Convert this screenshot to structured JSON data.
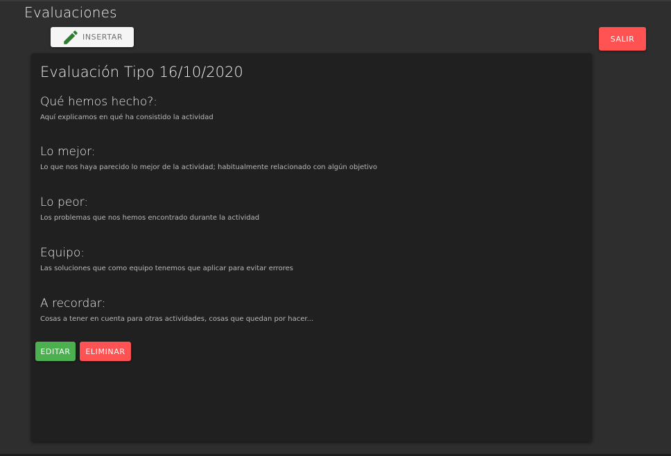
{
  "header": {
    "title": "Evaluaciones",
    "insert_label": "INSERTAR",
    "exit_label": "SALIR",
    "insert_icon": "pencil-icon"
  },
  "card": {
    "title": "Evaluación Tipo 16/10/2020",
    "sections": [
      {
        "heading": "Qué hemos hecho?:",
        "text": "Aquí explicamos en qué ha consistido la actividad"
      },
      {
        "heading": "Lo mejor:",
        "text": "Lo que nos haya parecido lo mejor de la actividad; habitualmente relacionado con algún objetivo"
      },
      {
        "heading": "Lo peor:",
        "text": "Los problemas que nos hemos encontrado durante la actividad"
      },
      {
        "heading": "Equipo:",
        "text": "Las soluciones que como equipo tenemos que aplicar para evitar errores"
      },
      {
        "heading": "A recordar:",
        "text": "Cosas a tener en cuenta para otras actividades, cosas que quedan por hacer..."
      }
    ],
    "edit_label": "EDITAR",
    "delete_label": "ELIMINAR"
  },
  "colors": {
    "background": "#2e2e2e",
    "card": "#202020",
    "danger": "#ff5252",
    "success": "#4caf50",
    "icon_green": "#2e7d32"
  }
}
